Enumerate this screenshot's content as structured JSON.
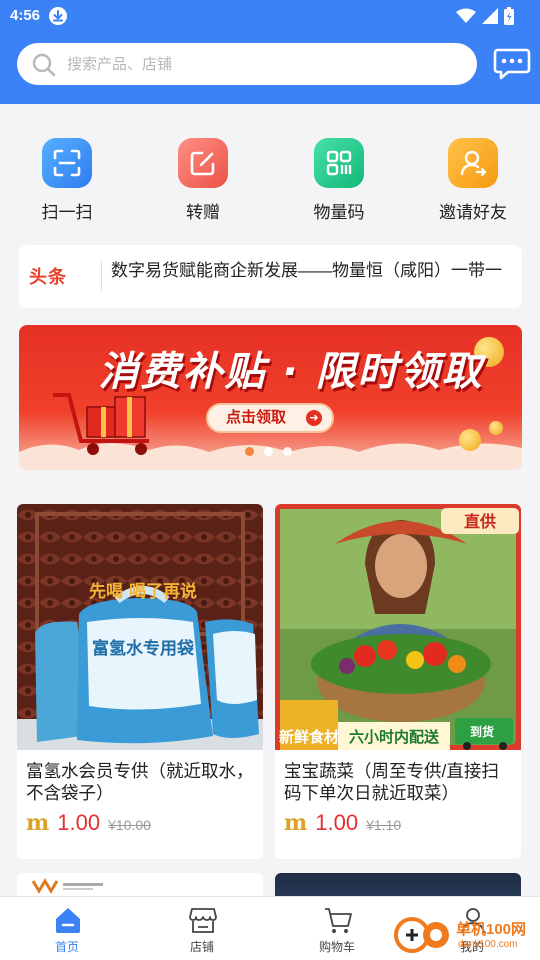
{
  "status_bar": {
    "time": "4:56"
  },
  "search": {
    "placeholder": "搜索产品、店铺",
    "value": ""
  },
  "quick_actions": [
    {
      "label": "扫一扫",
      "icon": "scan-icon",
      "color": "#2f8cf5"
    },
    {
      "label": "转赠",
      "icon": "edit-share-icon",
      "color": "#f0645a"
    },
    {
      "label": "物量码",
      "icon": "qr-code-icon",
      "color": "#20c98a"
    },
    {
      "label": "邀请好友",
      "icon": "invite-user-icon",
      "color": "#f7a21b"
    }
  ],
  "news": {
    "source_logo": "头条",
    "text": "数字易货赋能商企新发展——物量恒（咸阳）一带一"
  },
  "banner": {
    "title": "消费补贴 · 限时领取",
    "cta": "点击领取",
    "slide_count": 3,
    "active_slide": 1
  },
  "products": [
    {
      "title": "富氢水会员专供（就近取水，不含袋子）",
      "image_caption": "先喝 喝了再说",
      "bag_label": "富氢水专用袋",
      "price": "1.00",
      "original_price": "¥10.00"
    },
    {
      "title": "宝宝蔬菜（周至专供/直接扫码下单次日就近取菜）",
      "badge": "直供",
      "image_caption_left": "新鲜食材",
      "image_caption_right": "六小时内配送",
      "truck_label": "到货",
      "price": "1.00",
      "original_price": "¥1.10"
    }
  ],
  "tab_bar": {
    "items": [
      {
        "label": "首页",
        "icon": "home-icon",
        "active": true
      },
      {
        "label": "店铺",
        "icon": "store-icon",
        "active": false
      },
      {
        "label": "购物车",
        "icon": "cart-icon",
        "active": false
      },
      {
        "label": "我的",
        "icon": "profile-icon",
        "active": false
      }
    ]
  },
  "watermark": {
    "text": "单机100网",
    "sub": "danji100.com"
  },
  "colors": {
    "primary": "#3a82f5",
    "price": "#e33030",
    "background": "#f4f4f6"
  }
}
